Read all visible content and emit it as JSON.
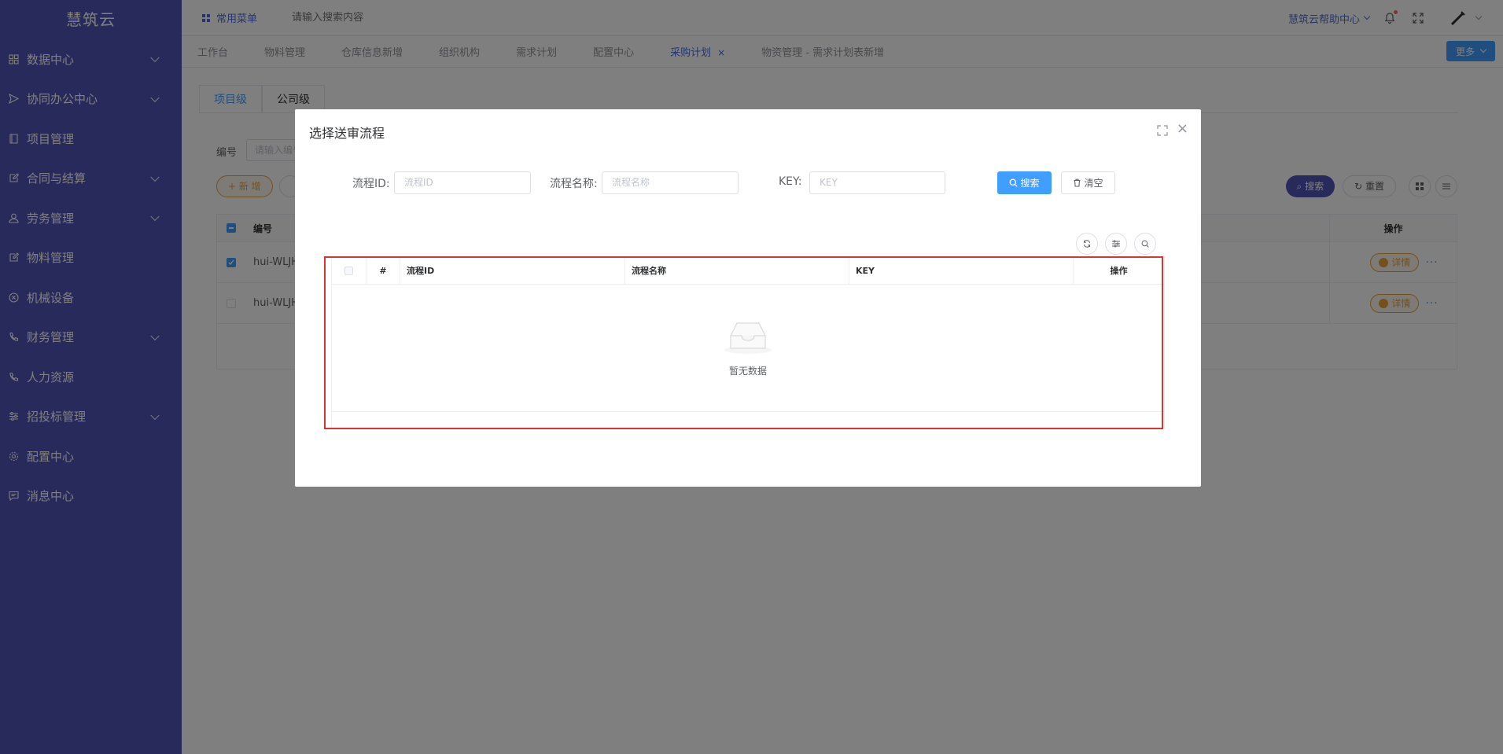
{
  "app": {
    "logo": "慧筑云"
  },
  "sidebar": {
    "items": [
      {
        "label": "数据中心",
        "icon": "grid-icon",
        "has_children": true
      },
      {
        "label": "协同办公中心",
        "icon": "send-icon",
        "has_children": true
      },
      {
        "label": "项目管理",
        "icon": "book-icon",
        "has_children": false
      },
      {
        "label": "合同与结算",
        "icon": "edit-icon",
        "has_children": true
      },
      {
        "label": "劳务管理",
        "icon": "user-icon",
        "has_children": true
      },
      {
        "label": "物料管理",
        "icon": "edit-icon",
        "has_children": false
      },
      {
        "label": "机械设备",
        "icon": "circle-x-icon",
        "has_children": false
      },
      {
        "label": "财务管理",
        "icon": "phone-icon",
        "has_children": true
      },
      {
        "label": "人力资源",
        "icon": "phone-icon",
        "has_children": false
      },
      {
        "label": "招投标管理",
        "icon": "sliders-icon",
        "has_children": true
      },
      {
        "label": "配置中心",
        "icon": "gear-icon",
        "has_children": false
      },
      {
        "label": "消息中心",
        "icon": "message-icon",
        "has_children": false
      }
    ]
  },
  "header": {
    "quick_menu": "常用菜单",
    "search_placeholder": "请输入搜索内容",
    "help": "慧筑云帮助中心"
  },
  "tabs": {
    "items": [
      {
        "label": "工作台",
        "active": false
      },
      {
        "label": "物料管理",
        "active": false
      },
      {
        "label": "仓库信息新增",
        "active": false
      },
      {
        "label": "组织机构",
        "active": false
      },
      {
        "label": "需求计划",
        "active": false
      },
      {
        "label": "配置中心",
        "active": false
      },
      {
        "label": "采购计划",
        "active": true,
        "close": "×"
      },
      {
        "label": "物资管理 - 需求计划表新增",
        "active": false
      }
    ],
    "more": "更多"
  },
  "page": {
    "sub_tabs": [
      "项目级",
      "公司级"
    ],
    "filter_label": "编号",
    "filter_placeholder": "请输入编号",
    "add_button": "+ 新 增",
    "search_button": "搜索",
    "reset_button": "重置",
    "table_headers": {
      "code": "编号",
      "op": "操作"
    },
    "rows": [
      {
        "code": "hui-WLJH",
        "checked": true,
        "detail": "详情",
        "more": "···"
      },
      {
        "code": "hui-WLJH",
        "checked": false,
        "detail": "详情",
        "more": "···"
      }
    ]
  },
  "dialog": {
    "title": "选择送审流程",
    "fields": {
      "process_id_label": "流程ID:",
      "process_id_placeholder": "流程ID",
      "process_name_label": "流程名称:",
      "process_name_placeholder": "流程名称",
      "key_label": "KEY:",
      "key_placeholder": "KEY"
    },
    "search_button": "搜索",
    "clear_button": "清空",
    "table": {
      "headers": {
        "index": "#",
        "process_id": "流程ID",
        "process_name": "流程名称",
        "key": "KEY",
        "op": "操作"
      },
      "empty_text": "暂无数据"
    }
  },
  "colors": {
    "sidebar_bg": "#5054b8",
    "primary": "#409eff",
    "warning": "#e6a23c",
    "highlight": "#e03131"
  }
}
